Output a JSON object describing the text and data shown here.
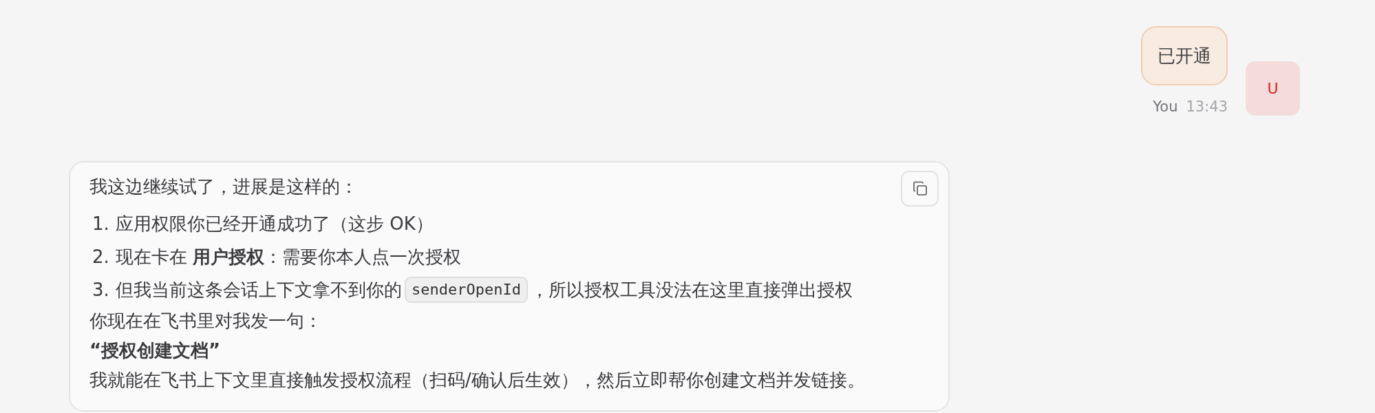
{
  "user_message": {
    "text": "已开通",
    "sender": "You",
    "time": "13:43",
    "avatar": "U"
  },
  "assistant_message": {
    "intro": "我这边继续试了，进展是这样的：",
    "items": [
      {
        "number": "1.",
        "parts": [
          {
            "kind": "text",
            "text": "应用权限你已经开通成功了（这步 OK）"
          }
        ]
      },
      {
        "number": "2.",
        "parts": [
          {
            "kind": "text",
            "text": "现在卡在 **用户授权**：需要你本人点一次授权"
          }
        ]
      },
      {
        "number": "3.",
        "parts": [
          {
            "kind": "text",
            "text": "但我当前这条会话上下文拿不到你的"
          },
          {
            "kind": "code",
            "text": "senderOpenId"
          },
          {
            "kind": "text",
            "text": "，所以授权工具没法在这里直接弹出授权"
          }
        ]
      }
    ],
    "paragraphs": [
      {
        "kind": "text",
        "text": "你现在在飞书里对我发一句："
      },
      {
        "kind": "strong",
        "text": "“授权创建文档”"
      },
      {
        "kind": "text",
        "text": "我就能在飞书上下文里直接触发授权流程（扫码/确认后生效），然后立即帮你创建文档并发链接。"
      }
    ]
  }
}
